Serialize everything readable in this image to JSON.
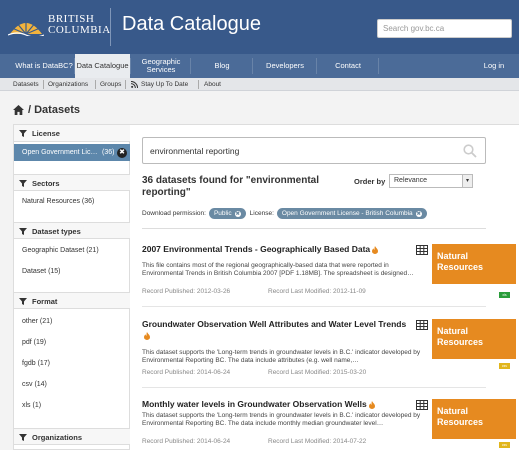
{
  "header": {
    "logo_line1": "BRITISH",
    "logo_line2": "COLUMBIA",
    "title": "Data Catalogue",
    "search_placeholder": "Search gov.bc.ca"
  },
  "nav": {
    "items": [
      {
        "label": "What is DataBC?"
      },
      {
        "label": "Data Catalogue"
      },
      {
        "label": "Geographic Services"
      },
      {
        "label": "Blog"
      },
      {
        "label": "Developers"
      },
      {
        "label": "Contact"
      }
    ],
    "login": "Log in"
  },
  "subnav": {
    "items": [
      "Datasets",
      "Organizations",
      "Groups",
      "Stay Up To Date",
      "About"
    ]
  },
  "breadcrumb": {
    "label": "/ Datasets"
  },
  "sidebar": {
    "license": {
      "heading": "License",
      "active": "Open Government Lic…",
      "active_count": "(36)"
    },
    "sectors": {
      "heading": "Sectors",
      "items": [
        "Natural Resources (36)"
      ]
    },
    "dataset_types": {
      "heading": "Dataset types",
      "items": [
        "Geographic Dataset (21)",
        "Dataset (15)"
      ]
    },
    "format": {
      "heading": "Format",
      "items": [
        "other (21)",
        "pdf (19)",
        "fgdb (17)",
        "csv (14)",
        "xls (1)"
      ]
    },
    "organizations": {
      "heading": "Organizations"
    }
  },
  "main": {
    "query": "environmental reporting",
    "results_title": "36 datasets found for \"environmental reporting\"",
    "order_label": "Order by",
    "order_value": "Relevance",
    "download_label": "Download permission:",
    "download_value": "Public",
    "license_label": "License:",
    "license_value": "Open Government License - British Columbia",
    "datasets": [
      {
        "title": "2007 Environmental Trends - Geographically Based Data",
        "description": "This file contains most of the regional geographically-based data that were reported in Environmental Trends in British Columbia 2007 [PDF 1.18MB]. The spreadsheet is designed…",
        "published": "Record Published: 2012-03-26",
        "modified": "Record Last Modified: 2012-11-09",
        "category": "Natural Resources",
        "format": "xls",
        "format_color": "#2a9d3b"
      },
      {
        "title": "Groundwater Observation Well Attributes and Water Level Trends",
        "description": "This dataset supports the 'Long-term trends in groundwater levels in B.C.' indicator developed by Environmental Reporting BC. The data include attributes (e.g. well name,…",
        "published": "Record Published: 2014-06-24",
        "modified": "Record Last Modified: 2015-03-20",
        "category": "Natural Resources",
        "format": "csv",
        "format_color": "#e1b51c"
      },
      {
        "title": "Monthly water levels in Groundwater Observation Wells",
        "description": "This dataset supports the 'Long-term trends in groundwater levels in B.C.' indicator developed by Environmental Reporting BC. The data include monthly median groundwater level…",
        "published": "Record Published: 2014-06-24",
        "modified": "Record Last Modified: 2014-07-22",
        "category": "Natural Resources",
        "format": "csv",
        "format_color": "#e1b51c"
      }
    ]
  },
  "colors": {
    "header_bg": "#38598a",
    "nav_bg": "#4b6b98",
    "accent_orange": "#e68a20",
    "active_filter": "#5d87ab"
  }
}
